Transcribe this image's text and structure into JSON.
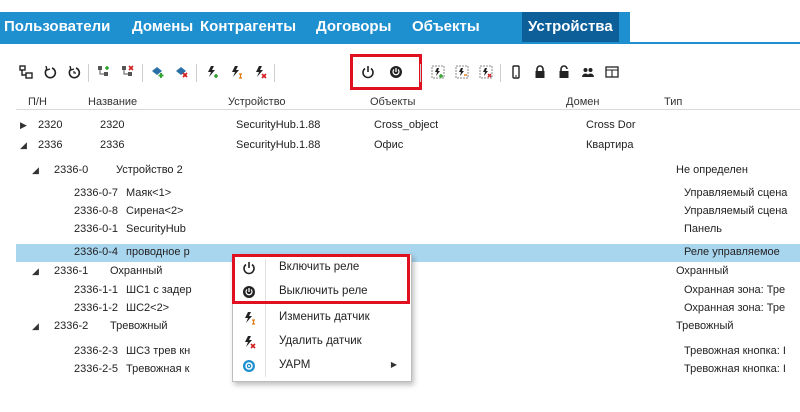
{
  "tabs": [
    {
      "label": "Пользователи"
    },
    {
      "label": "Домены"
    },
    {
      "label": "Контрагенты"
    },
    {
      "label": "Договоры"
    },
    {
      "label": "Объекты"
    },
    {
      "label": "Устройства"
    }
  ],
  "active_tab": "Устройства",
  "toolbar_icons": [
    "tree-icon",
    "rotate-left-icon",
    "rotate-timer-icon",
    "add-node-icon",
    "remove-node-icon",
    "add-device-icon",
    "remove-device-icon",
    "add-sensor-icon",
    "edit-sensor-icon",
    "delete-sensor-icon",
    "relay-on-icon",
    "relay-off-icon",
    "add-group-icon",
    "edit-group-icon",
    "delete-group-icon",
    "phone-icon",
    "lock-icon",
    "lock-open-icon",
    "users-icon",
    "window-icon"
  ],
  "columns": {
    "pn": "П/Н",
    "name": "Название",
    "device": "Устройство",
    "objects": "Объекты",
    "domain": "Домен",
    "type": "Тип"
  },
  "rows": [
    {
      "pn": "2320",
      "name": "2320",
      "device": "SecurityHub.1.88",
      "objects": "Cross_object",
      "domain": "Cross Dor",
      "type": "",
      "tri": "▶"
    },
    {
      "pn": "2336",
      "name": "2336",
      "device": "SecurityHub.1.88",
      "objects": "Офис",
      "domain": "Квартира",
      "type": "",
      "tri": "◢"
    },
    {
      "pn": "2336-0",
      "name": "Устройство 2",
      "device": "",
      "objects": "",
      "domain": "",
      "type": "Не определен",
      "tri": "◢"
    },
    {
      "pn": "2336-0-7",
      "name": "Маяк<1>",
      "device": "",
      "objects": "",
      "domain": "",
      "type": "Управляемый сцена",
      "tri": ""
    },
    {
      "pn": "2336-0-8",
      "name": "Сирена<2>",
      "device": "",
      "objects": "",
      "domain": "",
      "type": "Управляемый сцена",
      "tri": ""
    },
    {
      "pn": "2336-0-1",
      "name": "SecurityHub",
      "device": "",
      "objects": "",
      "domain": "",
      "type": "Панель",
      "tri": ""
    },
    {
      "pn": "2336-0-4",
      "name": "проводное р",
      "device": "",
      "objects": "",
      "domain": "",
      "type": "Реле управляемое",
      "tri": ""
    },
    {
      "pn": "2336-1",
      "name": "Охранный",
      "device": "",
      "objects": "",
      "domain": "",
      "type": "Охранный",
      "tri": "◢"
    },
    {
      "pn": "2336-1-1",
      "name": "ШС1 с задер",
      "device": "",
      "objects": "",
      "domain": "",
      "type": "Охранная зона: Тре",
      "tri": ""
    },
    {
      "pn": "2336-1-2",
      "name": "ШС2<2>",
      "device": "",
      "objects": "",
      "domain": "",
      "type": "Охранная зона: Тре",
      "tri": ""
    },
    {
      "pn": "2336-2",
      "name": "Тревожный",
      "device": "",
      "objects": "",
      "domain": "",
      "type": "Тревожный",
      "tri": "◢"
    },
    {
      "pn": "2336-2-3",
      "name": "ШС3 трев кн",
      "device": "",
      "objects": "",
      "domain": "",
      "type": "Тревожная кнопка: I",
      "tri": ""
    },
    {
      "pn": "2336-2-5",
      "name": "Тревожная к",
      "device": "",
      "objects": "",
      "domain": "",
      "type": "Тревожная кнопка: I",
      "tri": ""
    }
  ],
  "context_menu": [
    {
      "label": "Включить реле",
      "icon": "relay-on-icon"
    },
    {
      "label": "Выключить реле",
      "icon": "relay-off-icon"
    },
    {
      "label": "Изменить датчик",
      "icon": "edit-sensor-icon"
    },
    {
      "label": "Удалить датчик",
      "icon": "delete-sensor-icon"
    },
    {
      "label": "УАРМ",
      "icon": "uarm-icon",
      "submenu": true
    }
  ],
  "colors": {
    "accent": "#1e8fcf",
    "tab_active": "#0d5f9a",
    "selection": "#a9d6ef",
    "highlight": "#e01020"
  }
}
